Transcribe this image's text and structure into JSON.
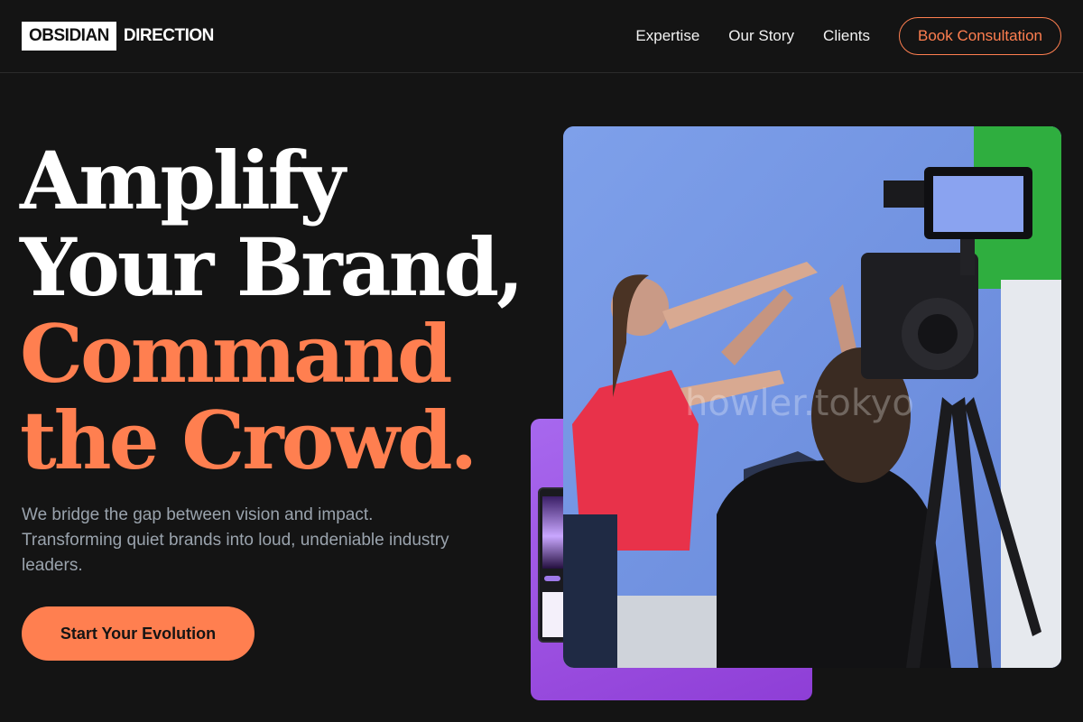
{
  "header": {
    "logo_boxed": "OBSIDIAN",
    "logo_text": "DIRECTION",
    "nav": [
      "Expertise",
      "Our Story",
      "Clients"
    ],
    "cta_label": "Book Consultation"
  },
  "hero": {
    "title_line1": "Amplify",
    "title_line2": "Your Brand,",
    "title_line3": "Command",
    "title_line4": "the Crowd.",
    "subtitle": "We bridge the gap between vision and impact. Transforming quiet brands into loud, undeniable industry leaders.",
    "cta_label": "Start Your Evolution"
  },
  "media": {
    "photo_watermark": "howler.tokyo"
  },
  "colors": {
    "background": "#141414",
    "accent": "#ff7f50",
    "purple": "#9b4fe0",
    "muted_text": "#9aa3ad"
  }
}
